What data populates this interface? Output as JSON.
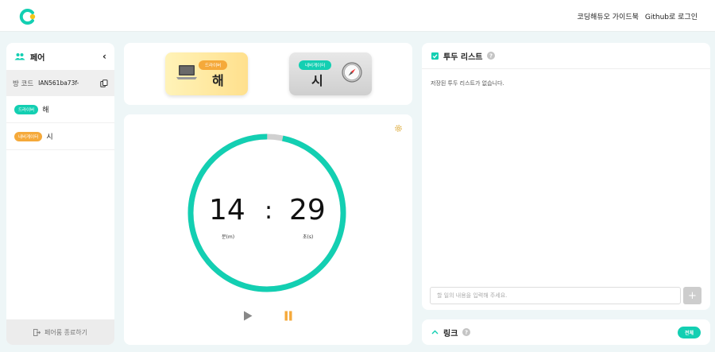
{
  "header": {
    "nav": [
      "코딩해듀오 가이드북",
      "Github로 로그인"
    ]
  },
  "sidebar": {
    "title": "페어",
    "room_label": "방 코드",
    "room_code": "IAN561ba73f-",
    "members": [
      {
        "role": "드라이버",
        "name": "해",
        "color": "#13cfb2"
      },
      {
        "role": "내비게이터",
        "name": "시",
        "color": "#f5a93a"
      }
    ],
    "end_label": "페어룸 종료하기"
  },
  "roles": {
    "driver": {
      "role": "드라이버",
      "name": "해"
    },
    "navigator": {
      "role": "내비게이터",
      "name": "시"
    }
  },
  "timer": {
    "minutes": "14",
    "seconds": "29",
    "colon": ":",
    "min_unit": "분(m)",
    "sec_unit": "초(s)",
    "progress": 0.967
  },
  "todo": {
    "title": "투두 리스트",
    "empty_text": "저장된 투두 리스트가 없습니다.",
    "placeholder": "할 일의 내용을 입력해 주세요.",
    "add_label": "+"
  },
  "links": {
    "title": "링크",
    "all_label": "전체"
  },
  "colors": {
    "accent": "#13cfb2",
    "orange": "#f5a93a"
  }
}
